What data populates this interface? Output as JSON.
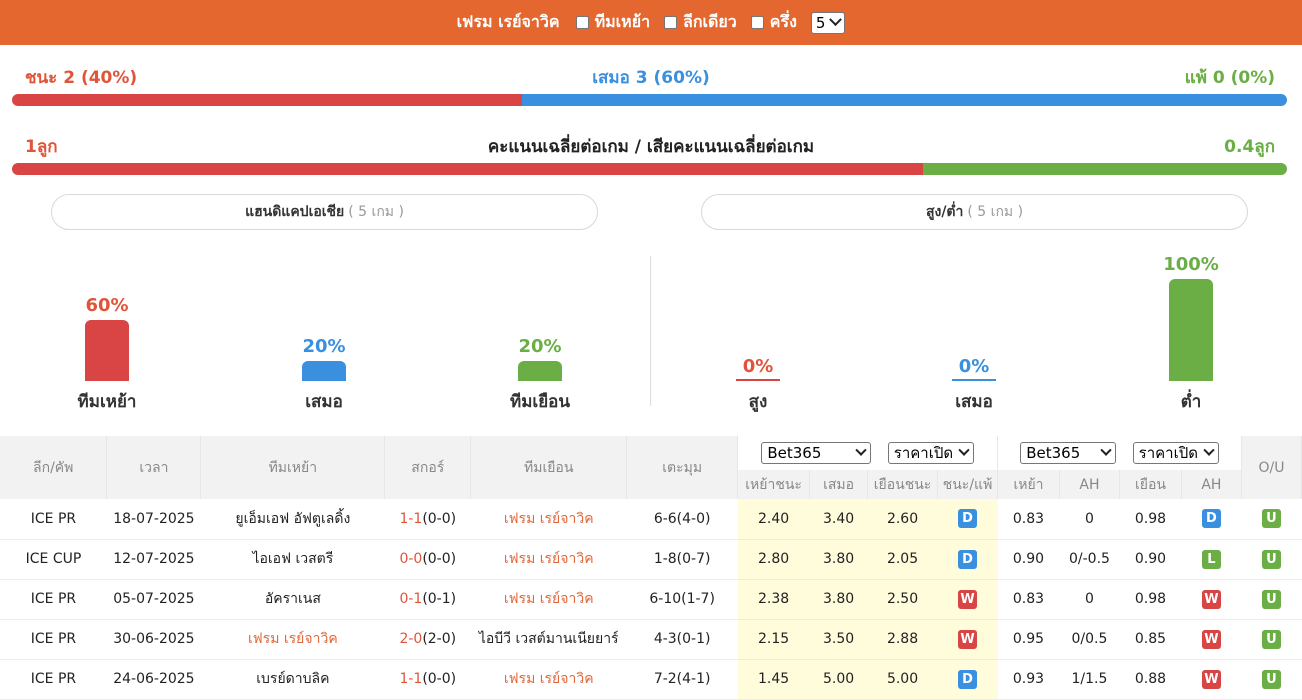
{
  "header": {
    "team_title": "เฟรม เรย์จาวิค",
    "filters": [
      {
        "label": "ทีมเหย้า",
        "checked": false
      },
      {
        "label": "ลีกเดียว",
        "checked": false
      },
      {
        "label": "ครึ่ง",
        "checked": false
      }
    ],
    "count_select": "5"
  },
  "summary": {
    "win_text": "ชนะ 2 (40%)",
    "draw_text": "เสมอ 3 (60%)",
    "loss_text": "แพ้ 0 (0%)",
    "win_pct": 40,
    "draw_pct": 60,
    "loss_pct": 0,
    "goals_for_text": "1ลูก",
    "goals_title": "คะแนนเฉลี่ยต่อเกม / เสียคะแนนเฉลี่ยต่อเกม",
    "goals_against_text": "0.4ลูก",
    "goals_for": 1,
    "goals_against": 0.4
  },
  "handicap": {
    "title": "แฮนดิแคปเอเชีย",
    "games": "( 5 เกม )",
    "bars": [
      {
        "label": "ทีมเหย้า",
        "pct_text": "60%",
        "pct": 60,
        "color": "#d94545",
        "text_color": "#e0553a"
      },
      {
        "label": "เสมอ",
        "pct_text": "20%",
        "pct": 20,
        "color": "#3a8fdf",
        "text_color": "#3a8fdf"
      },
      {
        "label": "ทีมเยือน",
        "pct_text": "20%",
        "pct": 20,
        "color": "#6aae45",
        "text_color": "#6aae45"
      }
    ]
  },
  "overunder": {
    "title": "สูง/ต่ำ",
    "games": "( 5 เกม )",
    "bars": [
      {
        "label": "สูง",
        "pct_text": "0%",
        "pct": 0,
        "color": "#d94545",
        "text_color": "#e0553a"
      },
      {
        "label": "เสมอ",
        "pct_text": "0%",
        "pct": 0,
        "color": "#3a8fdf",
        "text_color": "#3a8fdf"
      },
      {
        "label": "ต่ำ",
        "pct_text": "100%",
        "pct": 100,
        "color": "#6aae45",
        "text_color": "#6aae45"
      }
    ]
  },
  "table": {
    "headers": {
      "league": "ลีก/คัพ",
      "time": "เวลา",
      "home": "ทีมเหย้า",
      "score": "สกอร์",
      "away": "ทีมเยือน",
      "corners": "เตะมุม",
      "o1_book": "Bet365",
      "o1_type": "ราคาเปิด",
      "o1_h": "เหย้าชนะ",
      "o1_d": "เสมอ",
      "o1_a": "เยือนชนะ",
      "o1_r": "ชนะ/แพ้",
      "o2_book": "Bet365",
      "o2_type": "ราคาเปิด",
      "o2_h": "เหย้า",
      "o2_ah": "AH",
      "o2_a": "เยือน",
      "o2_r": "AH",
      "ou": "O/U"
    },
    "rows": [
      {
        "league": "ICE PR",
        "date": "18-07-2025",
        "home": "ยูเอ็มเอฟ อัฟตูเลดิ้ง",
        "home_hl": false,
        "score": "1-1",
        "ht": "(0-0)",
        "away": "เฟรม เรย์จาวิค",
        "away_hl": true,
        "corners": "6-6(4-0)",
        "h": "2.40",
        "d": "3.40",
        "a": "2.60",
        "r1": "D",
        "ah_h": "0.83",
        "ah": "0",
        "ah_a": "0.98",
        "r2": "D",
        "ou": "U"
      },
      {
        "league": "ICE CUP",
        "date": "12-07-2025",
        "home": "ไอเอฟ เวสตรี",
        "home_hl": false,
        "score": "0-0",
        "ht": "(0-0)",
        "away": "เฟรม เรย์จาวิค",
        "away_hl": true,
        "corners": "1-8(0-7)",
        "h": "2.80",
        "d": "3.80",
        "a": "2.05",
        "r1": "D",
        "ah_h": "0.90",
        "ah": "0/-0.5",
        "ah_a": "0.90",
        "r2": "L",
        "ou": "U"
      },
      {
        "league": "ICE PR",
        "date": "05-07-2025",
        "home": "อัคราเนส",
        "home_hl": false,
        "score": "0-1",
        "ht": "(0-1)",
        "away": "เฟรม เรย์จาวิค",
        "away_hl": true,
        "corners": "6-10(1-7)",
        "h": "2.38",
        "d": "3.80",
        "a": "2.50",
        "r1": "W",
        "ah_h": "0.83",
        "ah": "0",
        "ah_a": "0.98",
        "r2": "W",
        "ou": "U"
      },
      {
        "league": "ICE PR",
        "date": "30-06-2025",
        "home": "เฟรม เรย์จาวิค",
        "home_hl": true,
        "score": "2-0",
        "ht": "(2-0)",
        "away": "ไอบีวี เวสต์มานเนียยาร์",
        "away_hl": false,
        "corners": "4-3(0-1)",
        "h": "2.15",
        "d": "3.50",
        "a": "2.88",
        "r1": "W",
        "ah_h": "0.95",
        "ah": "0/0.5",
        "ah_a": "0.85",
        "r2": "W",
        "ou": "U"
      },
      {
        "league": "ICE PR",
        "date": "24-06-2025",
        "home": "เบรย์ดาบลิค",
        "home_hl": false,
        "score": "1-1",
        "ht": "(0-0)",
        "away": "เฟรม เรย์จาวิค",
        "away_hl": true,
        "corners": "7-2(4-1)",
        "h": "1.45",
        "d": "5.00",
        "a": "5.00",
        "r1": "D",
        "ah_h": "0.93",
        "ah": "1/1.5",
        "ah_a": "0.88",
        "r2": "W",
        "ou": "U"
      }
    ]
  }
}
